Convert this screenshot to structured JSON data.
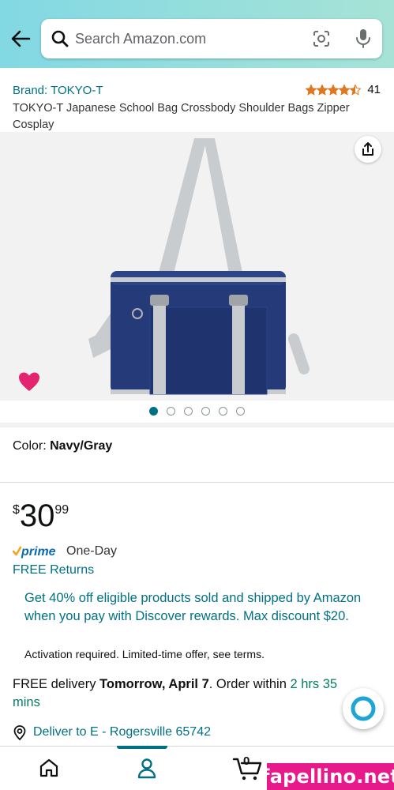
{
  "search": {
    "placeholder": "Search Amazon.com"
  },
  "icons": {
    "back": "back-arrow-icon",
    "search": "search-icon",
    "camera": "camera-scan-icon",
    "mic": "microphone-icon",
    "share": "share-icon",
    "heart": "heart-icon",
    "pin": "location-pin-icon",
    "alexa": "alexa-icon",
    "home": "home-icon",
    "account": "account-icon",
    "cart": "cart-icon"
  },
  "product": {
    "brand": "Brand: TOKYO-T",
    "rating_value": 4.5,
    "rating_count": "41",
    "title": "TOKYO-T Japanese School Bag Crossbody Shoulder Bags Zipper Cosplay",
    "image_count": 6,
    "active_image": 1,
    "color_label": "Color: ",
    "color_value": "Navy/Gray",
    "price_symbol": "$",
    "price_whole": "30",
    "price_fraction": "99",
    "prime_label": "One-Day",
    "free_returns": "FREE Returns"
  },
  "offer": {
    "text": "Get 40% off eligible products sold and shipped by Amazon when you pay with Discover rewards. Max discount $20.",
    "terms": "Activation required. Limited-time offer, see terms."
  },
  "delivery": {
    "prefix": "FREE delivery ",
    "date": "Tomorrow, April 7",
    "middle": ". Order within ",
    "countdown": "2 hrs 35 mins",
    "deliver_to": "Deliver to E - Rogersville 65742"
  },
  "nav": {
    "cart_count": "0",
    "active": "account"
  },
  "colors": {
    "accent": "#007185",
    "price_green": "#067d62",
    "prime_orange": "#f7a41d",
    "heart": "#e3246e",
    "bag_navy": "#243a79",
    "strap_gray": "#c9cccf"
  },
  "watermark": "fapellino.net"
}
